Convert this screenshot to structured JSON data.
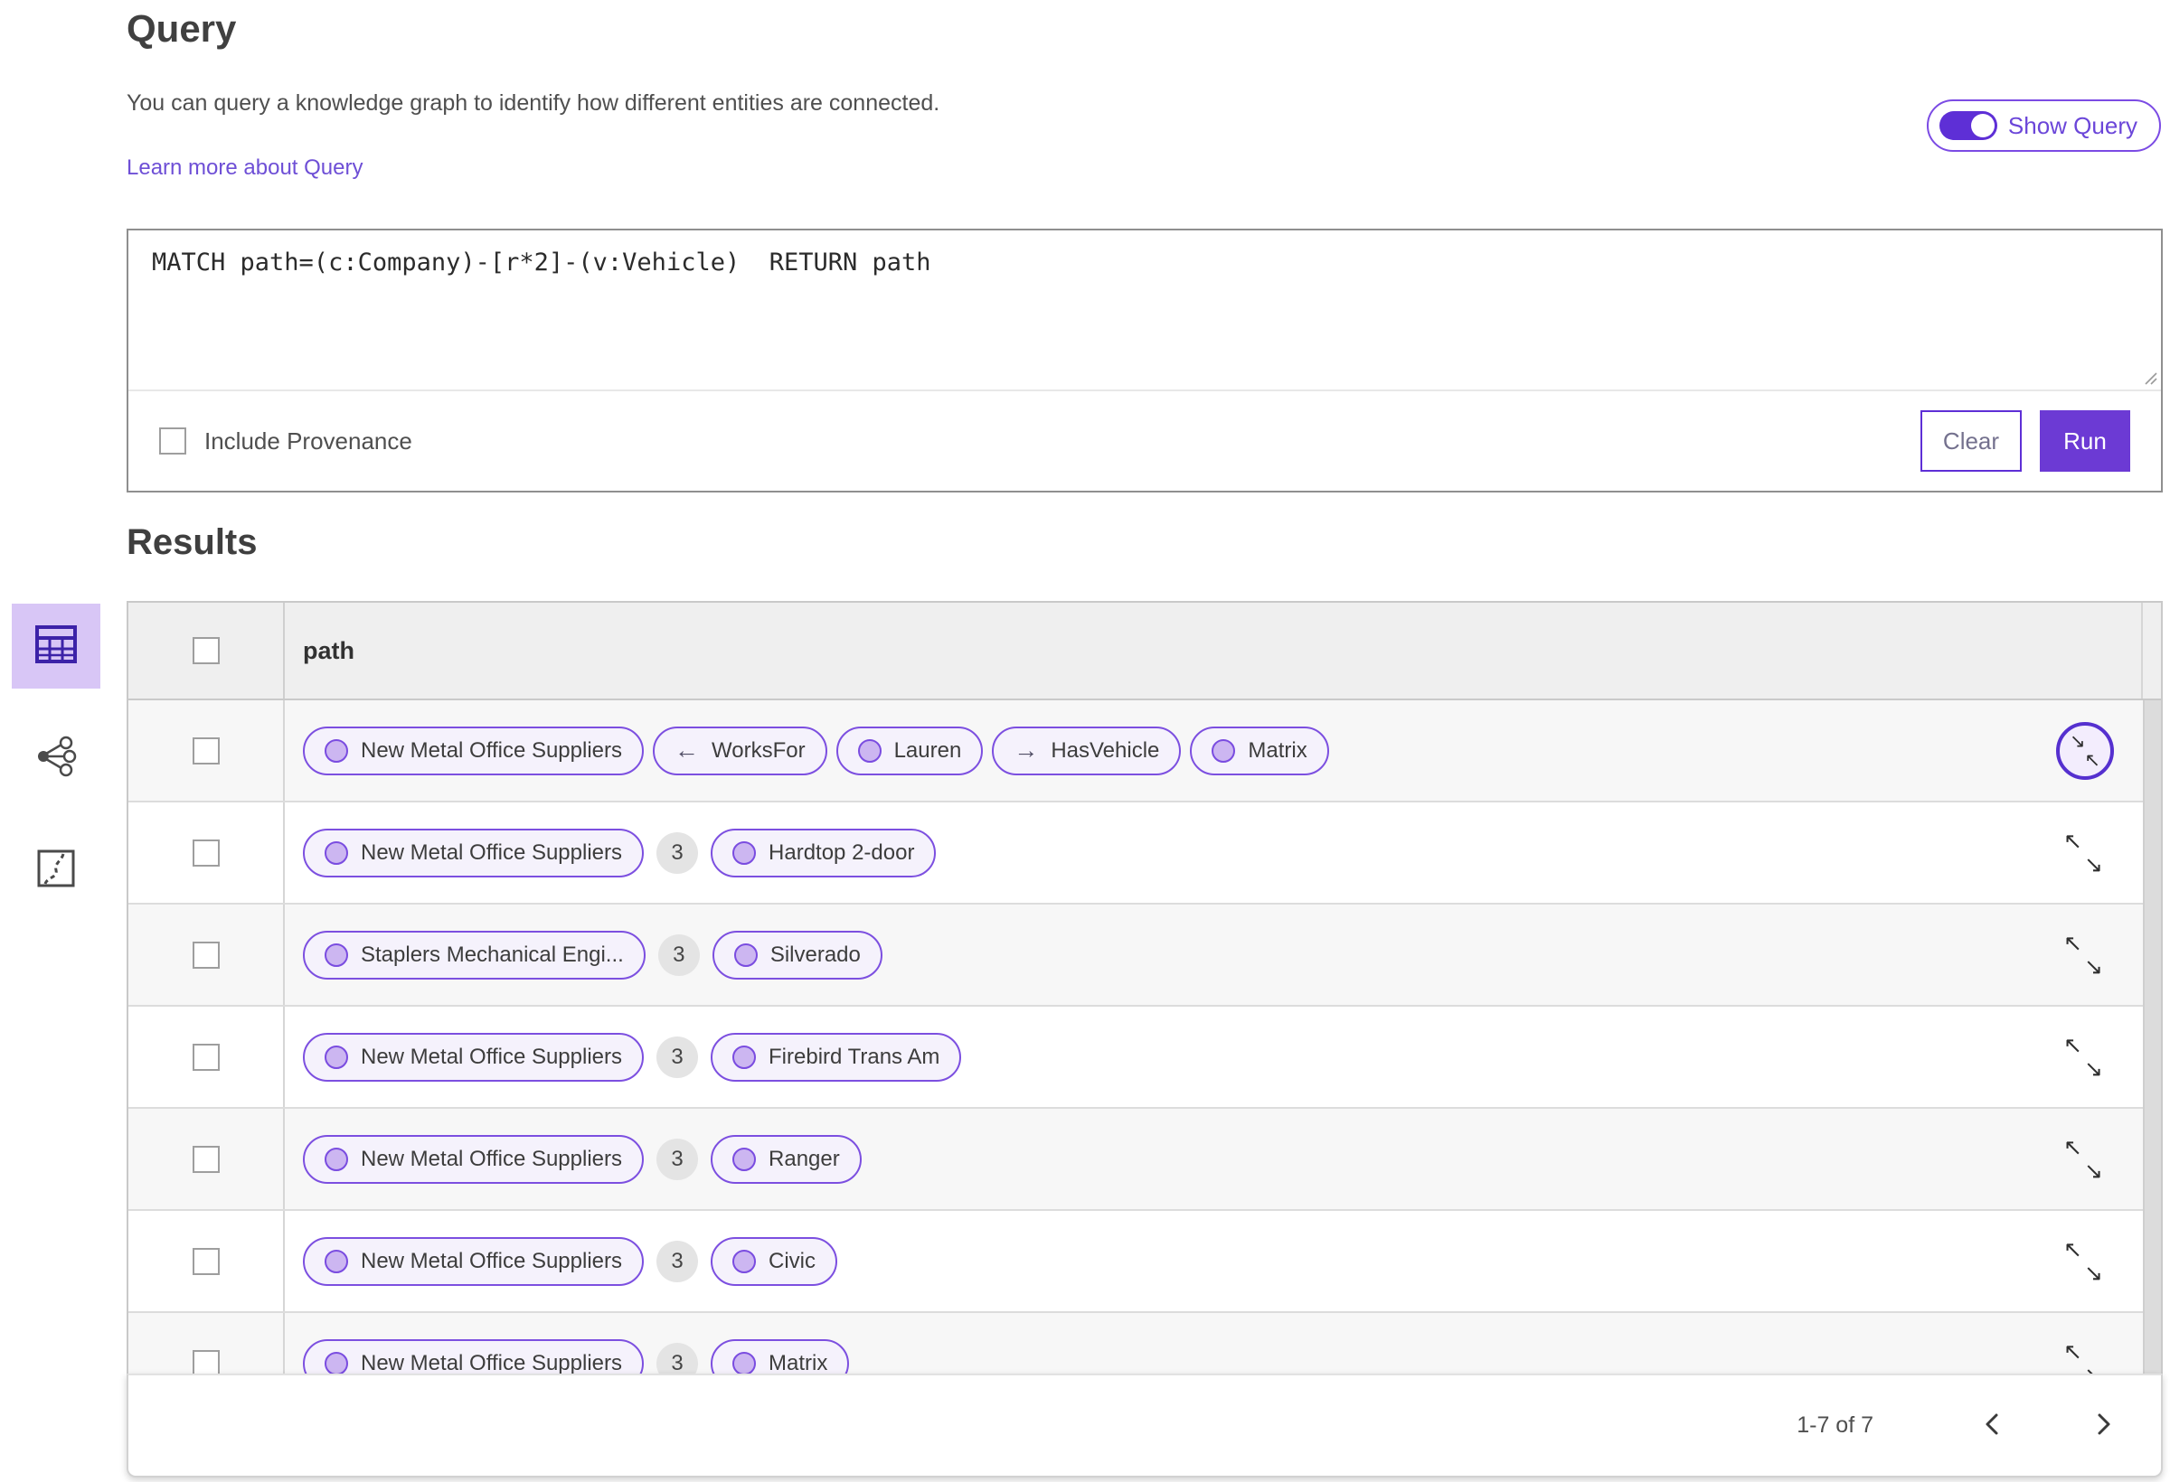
{
  "header": {
    "title": "Query",
    "description": "You can query a knowledge graph to identify how different entities are connected.",
    "learn_more_label": "Learn more about Query",
    "show_query_label": "Show Query",
    "show_query_on": true
  },
  "query_panel": {
    "query_text": "MATCH path=(c:Company)-[r*2]-(v:Vehicle)  RETURN path",
    "include_provenance_label": "Include Provenance",
    "include_provenance_checked": false,
    "clear_label": "Clear",
    "run_label": "Run"
  },
  "results": {
    "title": "Results",
    "column_header": "path",
    "view_rail": [
      {
        "name": "table-view-icon",
        "active": true
      },
      {
        "name": "link-chart-view-icon",
        "active": false
      },
      {
        "name": "map-view-icon",
        "active": false
      }
    ],
    "rows": [
      {
        "expander": "collapse-circle",
        "segments": [
          {
            "type": "entity",
            "label": "New Metal Office Suppliers"
          },
          {
            "type": "rel",
            "arrow": "←",
            "label": "WorksFor"
          },
          {
            "type": "entity",
            "label": "Lauren"
          },
          {
            "type": "rel",
            "arrow": "→",
            "label": "HasVehicle"
          },
          {
            "type": "entity",
            "label": "Matrix"
          }
        ]
      },
      {
        "expander": "expand",
        "segments": [
          {
            "type": "entity",
            "label": "New Metal Office Suppliers"
          },
          {
            "type": "count",
            "label": "3"
          },
          {
            "type": "entity",
            "label": "Hardtop 2-door"
          }
        ]
      },
      {
        "expander": "expand",
        "segments": [
          {
            "type": "entity",
            "label": "Staplers Mechanical Engi..."
          },
          {
            "type": "count",
            "label": "3"
          },
          {
            "type": "entity",
            "label": "Silverado"
          }
        ]
      },
      {
        "expander": "expand",
        "segments": [
          {
            "type": "entity",
            "label": "New Metal Office Suppliers"
          },
          {
            "type": "count",
            "label": "3"
          },
          {
            "type": "entity",
            "label": "Firebird Trans Am"
          }
        ]
      },
      {
        "expander": "expand",
        "segments": [
          {
            "type": "entity",
            "label": "New Metal Office Suppliers"
          },
          {
            "type": "count",
            "label": "3"
          },
          {
            "type": "entity",
            "label": "Ranger"
          }
        ]
      },
      {
        "expander": "expand",
        "segments": [
          {
            "type": "entity",
            "label": "New Metal Office Suppliers"
          },
          {
            "type": "count",
            "label": "3"
          },
          {
            "type": "entity",
            "label": "Civic"
          }
        ]
      },
      {
        "expander": "expand",
        "segments": [
          {
            "type": "entity",
            "label": "New Metal Office Suppliers"
          },
          {
            "type": "count",
            "label": "3"
          },
          {
            "type": "entity",
            "label": "Matrix"
          }
        ]
      }
    ],
    "pagination": {
      "range_label": "1-7 of 7"
    }
  },
  "colors": {
    "accent": "#6c3ad4",
    "pill_border": "#7c4fe0",
    "pill_bg": "#f5f2fc",
    "node_fill": "#ccb6f1",
    "active_rail_bg": "#d8c6f6",
    "header_bg": "#efefef",
    "zebra_row": "#f7f7f7"
  }
}
